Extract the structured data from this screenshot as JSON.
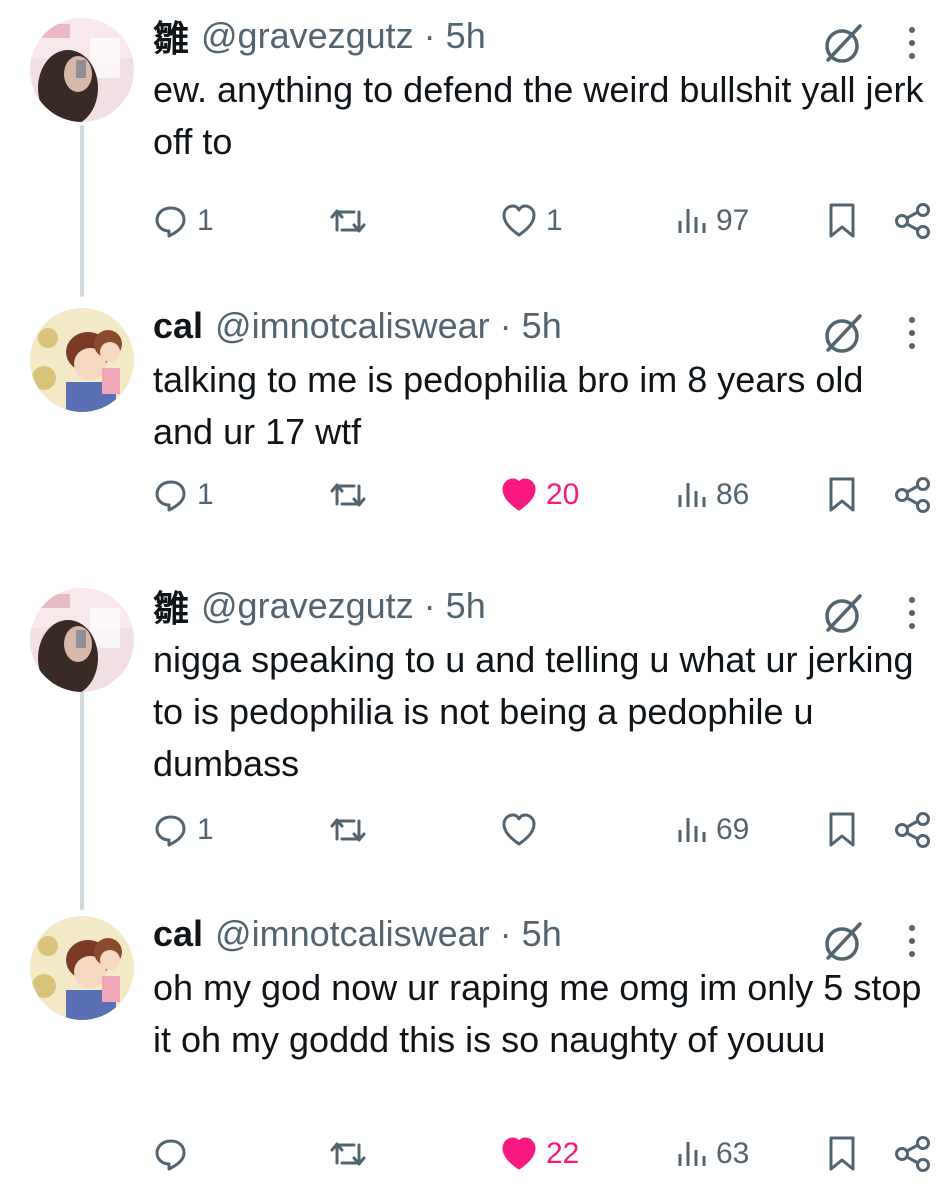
{
  "tweets": [
    {
      "display_name": "雛",
      "handle": "@gravezgutz",
      "time": "5h",
      "text": "ew. anything to defend the weird bullshit yall jerk off to",
      "replies": "1",
      "retweets": "",
      "likes": "1",
      "liked": false,
      "views": "97"
    },
    {
      "display_name": "cal",
      "handle": "@imnotcaliswear",
      "time": "5h",
      "text": "talking to me is pedophilia bro im 8 years old and ur 17 wtf",
      "replies": "1",
      "retweets": "",
      "likes": "20",
      "liked": true,
      "views": "86"
    },
    {
      "display_name": "雛",
      "handle": "@gravezgutz",
      "time": "5h",
      "text": "nigga speaking to u and telling u what ur jerking to is pedophilia is not being a pedophile u dumbass",
      "replies": "1",
      "retweets": "",
      "likes": "",
      "liked": false,
      "views": "69"
    },
    {
      "display_name": "cal",
      "handle": "@imnotcaliswear",
      "time": "5h",
      "text": "oh my god now ur raping me omg im only 5 stop it oh my goddd this is so naughty of youuu",
      "replies": "",
      "retweets": "",
      "likes": "22",
      "liked": true,
      "views": "63"
    }
  ],
  "separator": "·",
  "colors": {
    "text": "#0f1419",
    "secondary": "#536471",
    "like_active": "#f91880",
    "thread_line": "#cfd9de"
  },
  "icons": {
    "reply": "reply-icon",
    "retweet": "retweet-icon",
    "like": "heart-icon",
    "views": "views-icon",
    "bookmark": "bookmark-icon",
    "share": "share-icon",
    "grok": "grok-icon",
    "more": "more-icon"
  }
}
